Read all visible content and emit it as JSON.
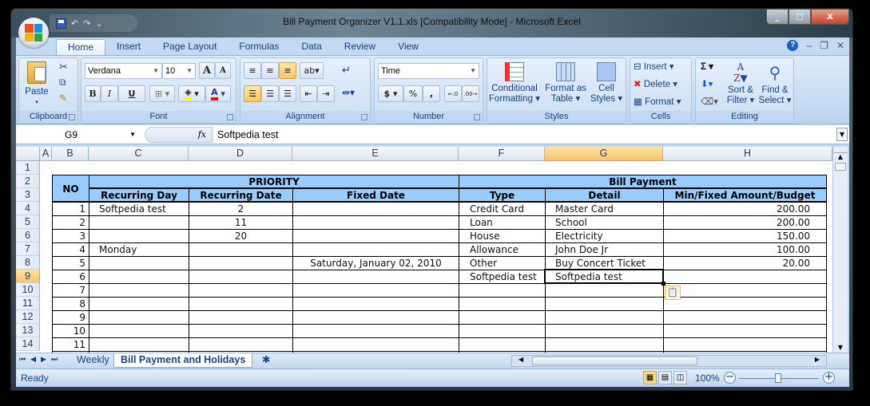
{
  "window": {
    "title": "Bill Payment Organizer V1.1.xls  [Compatibility Mode] - Microsoft Excel",
    "minimize": "_",
    "maximize": "□",
    "close": "X"
  },
  "qat": {
    "undo": "↶",
    "redo": "↷",
    "customize": "⌄"
  },
  "tabs": [
    "Home",
    "Insert",
    "Page Layout",
    "Formulas",
    "Data",
    "Review",
    "View"
  ],
  "active_tab": "Home",
  "ribbon": {
    "clipboard": {
      "label": "Clipboard",
      "paste": "Paste"
    },
    "font": {
      "label": "Font",
      "font_name": "Verdana",
      "font_size": "10",
      "bold": "B",
      "italic": "I",
      "underline": "U",
      "grow": "A",
      "shrink": "A",
      "font_color": "A"
    },
    "alignment": {
      "label": "Alignment"
    },
    "number": {
      "label": "Number",
      "format": "Time",
      "currency": "$",
      "percent": "%",
      "comma": ",",
      "inc_decimal": "←.0 .00",
      "dec_decimal": ".00 →.0"
    },
    "styles": {
      "label": "Styles",
      "conditional": "Conditional Formatting ▾",
      "format_table": "Format as Table ▾",
      "cell_styles": "Cell Styles ▾"
    },
    "cells": {
      "label": "Cells",
      "insert": "Insert ▾",
      "delete": "Delete ▾",
      "format": "Format ▾"
    },
    "editing": {
      "label": "Editing",
      "sigma": "Σ ▾",
      "sort_filter": "Sort & Filter ▾",
      "find_select": "Find & Select ▾"
    }
  },
  "formula_bar": {
    "name_box": "G9",
    "fx": "fx",
    "value": "Softpedia test"
  },
  "columns": [
    "A",
    "B",
    "C",
    "D",
    "E",
    "F",
    "G",
    "H"
  ],
  "rows": [
    "1",
    "2",
    "3",
    "4",
    "5",
    "6",
    "7",
    "8",
    "9",
    "10",
    "11",
    "12",
    "13",
    "14"
  ],
  "selected_cell": "G9",
  "sheet": {
    "headers": {
      "no": "NO",
      "priority": "PRIORITY",
      "bill_payment": "Bill Payment",
      "recurring_day": "Recurring Day",
      "recurring_date": "Recurring Date",
      "fixed_date": "Fixed Date",
      "type": "Type",
      "detail": "Detail",
      "amount": "Min/Fixed Amount/Budget"
    },
    "data_rows": [
      {
        "no": "1",
        "recurring_day": "Softpedia test",
        "recurring_date": "2",
        "fixed_date": "",
        "type": "Credit Card",
        "detail": "Master Card",
        "amount": "200.00"
      },
      {
        "no": "2",
        "recurring_day": "",
        "recurring_date": "11",
        "fixed_date": "",
        "type": "Loan",
        "detail": "School",
        "amount": "200.00"
      },
      {
        "no": "3",
        "recurring_day": "",
        "recurring_date": "20",
        "fixed_date": "",
        "type": "House",
        "detail": "Electricity",
        "amount": "150.00"
      },
      {
        "no": "4",
        "recurring_day": "Monday",
        "recurring_date": "",
        "fixed_date": "",
        "type": "Allowance",
        "detail": "John Doe Jr",
        "amount": "100.00"
      },
      {
        "no": "5",
        "recurring_day": "",
        "recurring_date": "",
        "fixed_date": "Saturday, January 02, 2010",
        "type": "Other",
        "detail": "Buy Concert Ticket",
        "amount": "20.00"
      },
      {
        "no": "6",
        "recurring_day": "",
        "recurring_date": "",
        "fixed_date": "",
        "type": "Softpedia test",
        "detail": "Softpedia test",
        "amount": ""
      },
      {
        "no": "7",
        "recurring_day": "",
        "recurring_date": "",
        "fixed_date": "",
        "type": "",
        "detail": "",
        "amount": ""
      },
      {
        "no": "8",
        "recurring_day": "",
        "recurring_date": "",
        "fixed_date": "",
        "type": "",
        "detail": "",
        "amount": ""
      },
      {
        "no": "9",
        "recurring_day": "",
        "recurring_date": "",
        "fixed_date": "",
        "type": "",
        "detail": "",
        "amount": ""
      },
      {
        "no": "10",
        "recurring_day": "",
        "recurring_date": "",
        "fixed_date": "",
        "type": "",
        "detail": "",
        "amount": ""
      },
      {
        "no": "11",
        "recurring_day": "",
        "recurring_date": "",
        "fixed_date": "",
        "type": "",
        "detail": "",
        "amount": ""
      }
    ]
  },
  "sheet_tabs": [
    "Weekly",
    "Bill Payment and Holidays"
  ],
  "active_sheet": "Bill Payment and Holidays",
  "status": {
    "text": "Ready",
    "zoom": "100%"
  },
  "colors": {
    "header_fill": "#99ccff",
    "selection": "#f8c36a",
    "ribbon": "#c3d9f3"
  }
}
